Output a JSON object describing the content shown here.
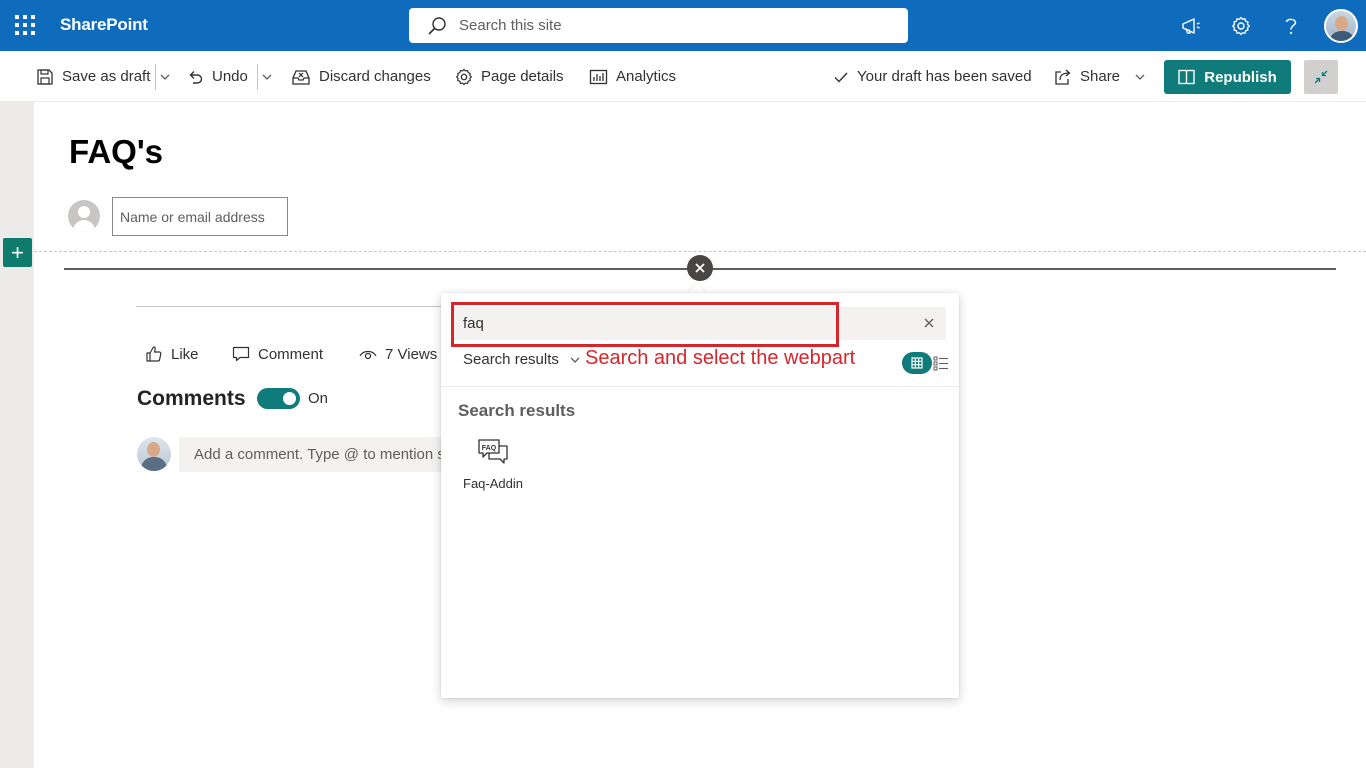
{
  "suite_bar": {
    "app_name": "SharePoint",
    "search_placeholder": "Search this site",
    "icons": [
      "waffle-icon",
      "megaphone-icon",
      "settings-icon",
      "help-icon",
      "avatar"
    ]
  },
  "command_bar": {
    "save_as_draft": "Save as draft",
    "undo": "Undo",
    "discard_changes": "Discard changes",
    "page_details": "Page details",
    "analytics": "Analytics",
    "draft_status": "Your draft has been saved",
    "share": "Share",
    "republish": "Republish"
  },
  "page": {
    "title": "FAQ's",
    "author_placeholder": "Name or email address"
  },
  "social": {
    "like": "Like",
    "comment": "Comment",
    "views": "7 Views"
  },
  "comments": {
    "heading": "Comments",
    "toggle_label": "On",
    "toggle_on": true,
    "placeholder": "Add a comment. Type @ to mention s"
  },
  "toolbox": {
    "search_value": "faq",
    "filter_label": "Search results",
    "annotation": "Search and select the webpart",
    "section_title": "Search results",
    "items": [
      {
        "label": "Faq-Addin",
        "icon": "faq-chat-icon"
      }
    ]
  },
  "colors": {
    "brand_blue": "#0f6cbd",
    "accent_teal": "#0f7b7b",
    "annotation_red": "#d7262b"
  }
}
